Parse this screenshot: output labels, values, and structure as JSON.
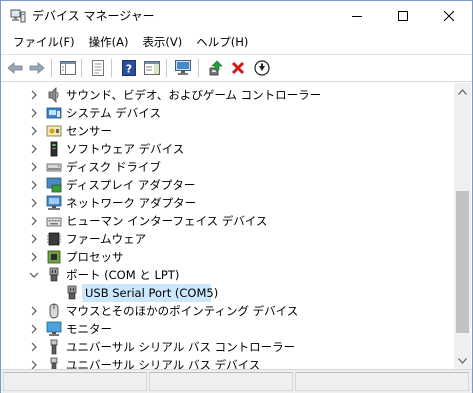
{
  "window": {
    "title": "デバイス マネージャー"
  },
  "menu": [
    {
      "label": "ファイル(F)"
    },
    {
      "label": "操作(A)"
    },
    {
      "label": "表示(V)"
    },
    {
      "label": "ヘルプ(H)"
    }
  ],
  "tree": {
    "selected_color": "#cce8ff",
    "items": [
      {
        "label": "サウンド、ビデオ、およびゲーム コントローラー",
        "icon": "speaker-icon",
        "expanded": false,
        "level": 0
      },
      {
        "label": "システム デバイス",
        "icon": "system-folder-icon",
        "expanded": false,
        "level": 0
      },
      {
        "label": "センサー",
        "icon": "sensor-icon",
        "expanded": false,
        "level": 0
      },
      {
        "label": "ソフトウェア デバイス",
        "icon": "software-device-icon",
        "expanded": false,
        "level": 0
      },
      {
        "label": "ディスク ドライブ",
        "icon": "disk-drive-icon",
        "expanded": false,
        "level": 0
      },
      {
        "label": "ディスプレイ アダプター",
        "icon": "display-adapter-icon",
        "expanded": false,
        "level": 0
      },
      {
        "label": "ネットワーク アダプター",
        "icon": "network-adapter-icon",
        "expanded": false,
        "level": 0
      },
      {
        "label": "ヒューマン インターフェイス デバイス",
        "icon": "hid-icon",
        "expanded": false,
        "level": 0
      },
      {
        "label": "ファームウェア",
        "icon": "firmware-icon",
        "expanded": false,
        "level": 0
      },
      {
        "label": "プロセッサ",
        "icon": "processor-icon",
        "expanded": false,
        "level": 0
      },
      {
        "label": "ポート (COM と LPT)",
        "icon": "port-icon",
        "expanded": true,
        "level": 0
      },
      {
        "label": "USB Serial Port (COM5)",
        "icon": "port-icon",
        "selected": true,
        "level": 1
      },
      {
        "label": "マウスとそのほかのポインティング デバイス",
        "icon": "mouse-icon",
        "expanded": false,
        "level": 0
      },
      {
        "label": "モニター",
        "icon": "monitor-icon",
        "expanded": false,
        "level": 0
      },
      {
        "label": "ユニバーサル シリアル バス コントローラー",
        "icon": "usb-icon",
        "expanded": false,
        "level": 0
      },
      {
        "label": "ユニバーサル シリアル バス デバイス",
        "icon": "usb-icon",
        "expanded": false,
        "level": 0
      }
    ]
  }
}
